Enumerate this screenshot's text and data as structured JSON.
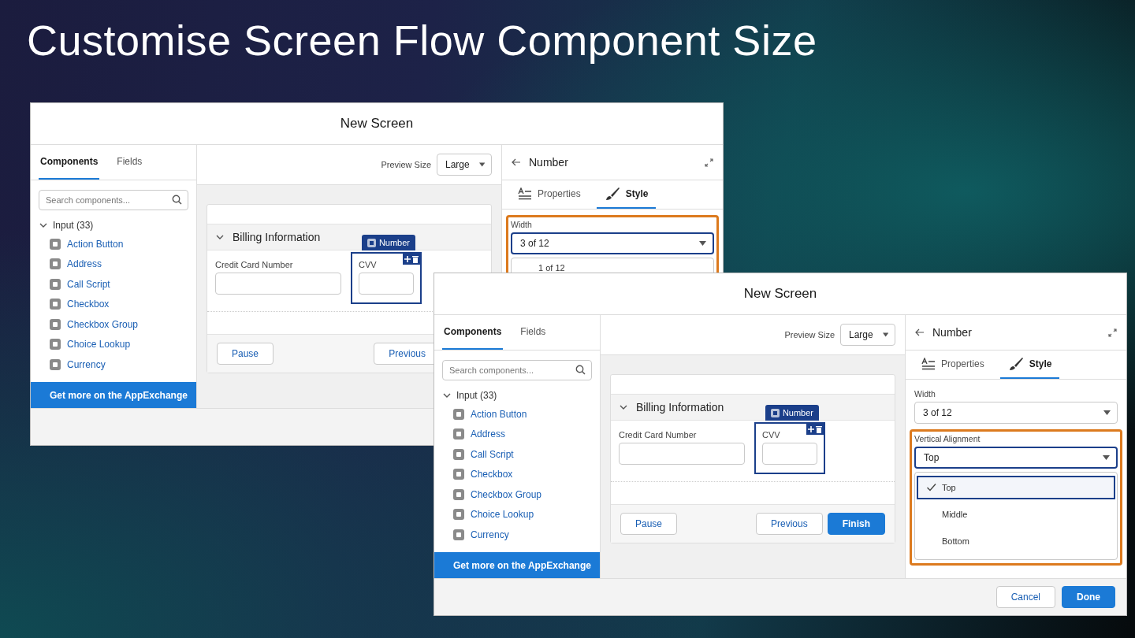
{
  "title": "Customise Screen Flow Component Size",
  "windows": [
    {
      "title": "New Screen",
      "left_tabs": [
        {
          "label": "Components",
          "selected": true
        },
        {
          "label": "Fields",
          "selected": false
        }
      ],
      "search": {
        "placeholder": "Search components..."
      },
      "group": {
        "label": "Input (33)",
        "expanded": true,
        "items": [
          {
            "label": "Action Button"
          },
          {
            "label": "Address"
          },
          {
            "label": "Call Script"
          },
          {
            "label": "Checkbox"
          },
          {
            "label": "Checkbox Group"
          },
          {
            "label": "Choice Lookup"
          },
          {
            "label": "Currency"
          }
        ]
      },
      "appexchange_link": "Get more on the AppExchange",
      "preview_size": {
        "label": "Preview Size",
        "value": "Large"
      },
      "section": {
        "title": "Billing Information",
        "expanded": true
      },
      "fields": [
        {
          "label": "Credit Card Number",
          "selected": false
        },
        {
          "label": "CVV",
          "selected": true,
          "badge": "Number"
        }
      ],
      "nav_buttons": [
        {
          "label": "Pause",
          "kind": "neutral"
        },
        {
          "label": "Previous",
          "kind": "neutral"
        }
      ],
      "panel": {
        "title": "Number",
        "tabs": [
          {
            "label": "Properties",
            "selected": false
          },
          {
            "label": "Style",
            "selected": true
          }
        ],
        "properties": [
          {
            "label": "Width",
            "value": "3 of 12",
            "highlighted": true,
            "open": true,
            "options": [
              {
                "label": "1 of 12",
                "selected": false
              }
            ]
          }
        ]
      }
    },
    {
      "title": "New Screen",
      "left_tabs": [
        {
          "label": "Components",
          "selected": true
        },
        {
          "label": "Fields",
          "selected": false
        }
      ],
      "search": {
        "placeholder": "Search components..."
      },
      "group": {
        "label": "Input (33)",
        "expanded": true,
        "items": [
          {
            "label": "Action Button"
          },
          {
            "label": "Address"
          },
          {
            "label": "Call Script"
          },
          {
            "label": "Checkbox"
          },
          {
            "label": "Checkbox Group"
          },
          {
            "label": "Choice Lookup"
          },
          {
            "label": "Currency"
          }
        ]
      },
      "appexchange_link": "Get more on the AppExchange",
      "preview_size": {
        "label": "Preview Size",
        "value": "Large"
      },
      "section": {
        "title": "Billing Information",
        "expanded": true
      },
      "fields": [
        {
          "label": "Credit Card Number",
          "selected": false
        },
        {
          "label": "CVV",
          "selected": true,
          "badge": "Number"
        }
      ],
      "nav_buttons": [
        {
          "label": "Pause",
          "kind": "neutral"
        },
        {
          "label": "Previous",
          "kind": "neutral"
        },
        {
          "label": "Finish",
          "kind": "brand"
        }
      ],
      "panel": {
        "title": "Number",
        "tabs": [
          {
            "label": "Properties",
            "selected": false
          },
          {
            "label": "Style",
            "selected": true
          }
        ],
        "properties": [
          {
            "label": "Width",
            "value": "3 of 12",
            "highlighted": false,
            "open": false
          },
          {
            "label": "Vertical Alignment",
            "value": "Top",
            "highlighted": true,
            "open": true,
            "options": [
              {
                "label": "Top",
                "selected": true
              },
              {
                "label": "Middle",
                "selected": false
              },
              {
                "label": "Bottom",
                "selected": false
              }
            ]
          }
        ]
      },
      "footer_buttons": [
        {
          "label": "Cancel",
          "kind": "neutral"
        },
        {
          "label": "Done",
          "kind": "brand"
        }
      ]
    }
  ]
}
